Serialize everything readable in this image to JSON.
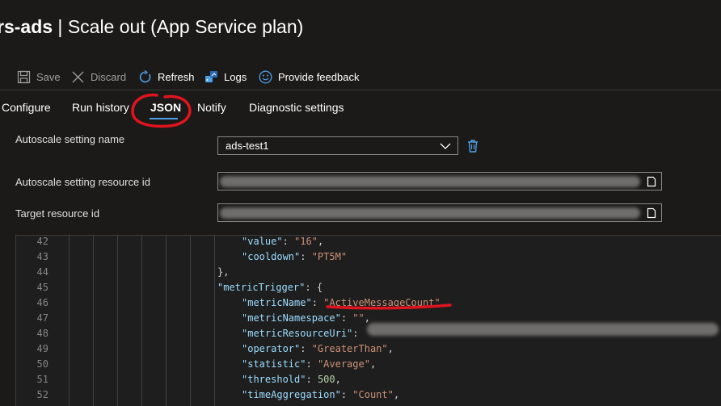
{
  "header": {
    "title_resource": "rs-ads",
    "title_separator": " | ",
    "title_page": "Scale out (App Service plan)"
  },
  "toolbar": {
    "save": "Save",
    "discard": "Discard",
    "refresh": "Refresh",
    "logs": "Logs",
    "feedback": "Provide feedback"
  },
  "tabs": [
    "Configure",
    "Run history",
    "JSON",
    "Notify",
    "Diagnostic settings"
  ],
  "active_tab": "JSON",
  "form": {
    "setting_name_label": "Autoscale setting name",
    "setting_name_value": "ads-test1",
    "resource_id_label": "Autoscale setting resource id",
    "target_label": "Target resource id"
  },
  "editor": {
    "lines": [
      {
        "num": "42",
        "key": "\"value\"",
        "sep": ": ",
        "val": "\"16\"",
        "end": ","
      },
      {
        "num": "43",
        "key": "\"cooldown\"",
        "sep": ": ",
        "val": "\"PT5M\"",
        "end": ""
      },
      {
        "num": "44",
        "key": "",
        "sep": "",
        "val": "",
        "end": "},"
      },
      {
        "num": "45",
        "key": "\"metricTrigger\"",
        "sep": ": ",
        "val": "",
        "end": "{"
      },
      {
        "num": "46",
        "key": "\"metricName\"",
        "sep": ": ",
        "val": "\"ActiveMessageCount\"",
        "end": ","
      },
      {
        "num": "47",
        "key": "\"metricNamespace\"",
        "sep": ": ",
        "val": "\"\"",
        "end": ","
      },
      {
        "num": "48",
        "key": "\"metricResourceUri\"",
        "sep": ":",
        "val": "",
        "end": ""
      },
      {
        "num": "49",
        "key": "\"operator\"",
        "sep": ": ",
        "val": "\"GreaterThan\"",
        "end": ","
      },
      {
        "num": "50",
        "key": "\"statistic\"",
        "sep": ": ",
        "val": "\"Average\"",
        "end": ","
      },
      {
        "num": "51",
        "key": "\"threshold\"",
        "sep": ": ",
        "num_val": "500",
        "end": ","
      },
      {
        "num": "52",
        "key": "\"timeAggregation\"",
        "sep": ": ",
        "val": "\"Count\"",
        "end": ","
      }
    ]
  },
  "colors": {
    "background": "#1b1a19",
    "accent": "#4f9fe6",
    "annotation": "#e0141e"
  }
}
